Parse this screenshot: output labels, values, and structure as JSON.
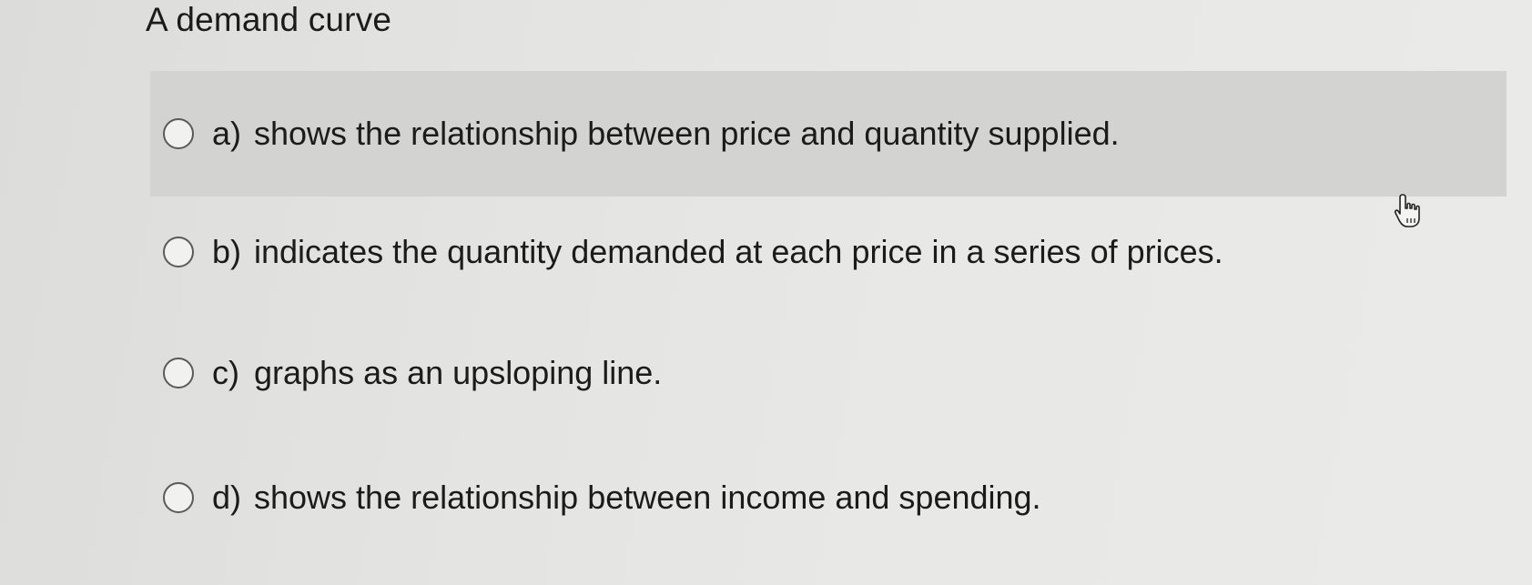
{
  "question": {
    "stem": "A demand curve"
  },
  "options": [
    {
      "letter": "a)",
      "text": "shows the relationship between price and quantity supplied."
    },
    {
      "letter": "b)",
      "text": "indicates the quantity demanded at each price in a series of prices."
    },
    {
      "letter": "c)",
      "text": "graphs as an upsloping line."
    },
    {
      "letter": "d)",
      "text": "shows the relationship between income and spending."
    }
  ],
  "state": {
    "hovered_option": "a)",
    "selected_option": null
  },
  "colors": {
    "hover_background": "#d3d3d1",
    "text": "#1b1b1b",
    "radio_border": "#5a5a5a"
  },
  "icons": {
    "pointer": "hand-pointer-icon"
  }
}
